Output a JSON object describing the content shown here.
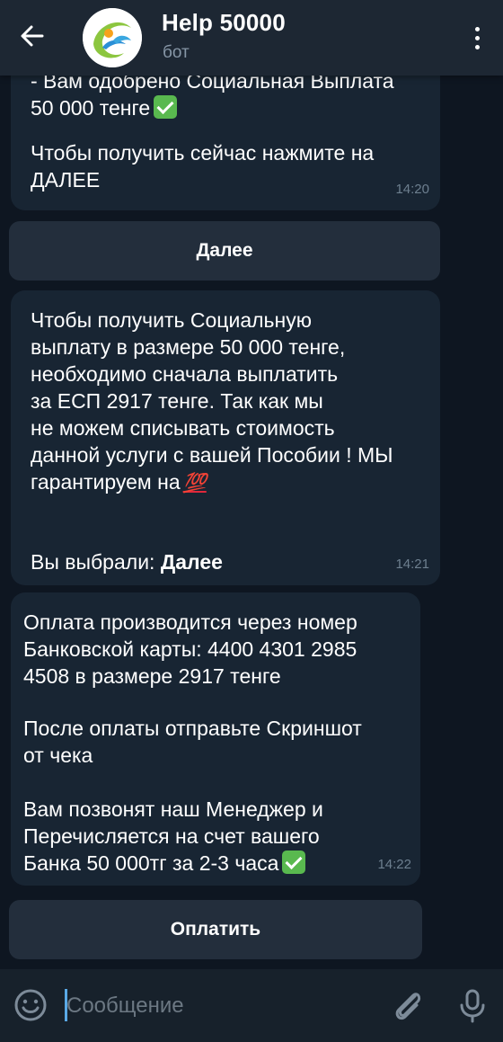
{
  "header": {
    "back_icon": "arrow-back-icon",
    "title": "Help 50000",
    "subtitle": "бот",
    "menu_icon": "more-vertical-icon"
  },
  "messages": [
    {
      "text": "- Вам одобрено Социальная Выплата\n50 000 тенге",
      "emoji": "check-mark-button",
      "text2": "Чтобы получить сейчас нажмите на\nДАЛЕЕ",
      "time": "14:20"
    },
    {
      "text": "Чтобы получить Социальную\nвыплату в размере 50 000 тенге,\nнеобходимо сначала выплатить\nза ЕСП 2917 тенге. Так как мы\nне можем списывать стоимость\nданной услуги с вашей Пособии ! МЫ\nгарантируем на",
      "emoji_text": "💯",
      "choice_prefix": "Вы выбрали: ",
      "choice_value": "Далее",
      "time": "14:21"
    },
    {
      "text": "Оплата производится через номер\nБанковской карты: 4400 4301 2985\n4508 в размере 2917 тенге",
      "text2": "После оплаты отправьте Скриншот\nот чека",
      "text3": "Вам позвонят наш Менеджер и\nПеречисляется на счет вашего\nБанка 50 000тг за  2-3 часа",
      "emoji": "check-mark-button",
      "time": "14:22"
    }
  ],
  "buttons": {
    "next_label": "Далее",
    "pay_label": "Оплатить"
  },
  "input": {
    "placeholder": "Сообщение",
    "value": ""
  },
  "colors": {
    "background": "#0e1621",
    "bubble": "#182533",
    "header": "#1d2733",
    "button": "#232e3c",
    "time": "#6d7f8f",
    "check": "#59b94f"
  }
}
